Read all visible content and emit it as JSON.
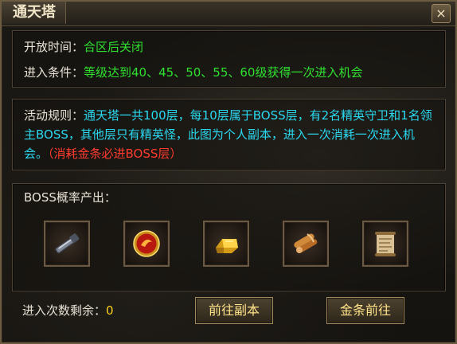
{
  "window": {
    "title": "通天塔",
    "close_icon": "close-icon"
  },
  "info": {
    "open_time_label": "开放时间：",
    "open_time_value": "合区后关闭",
    "entry_label": "进入条件：",
    "entry_value": "等级达到40、45、50、55、60级获得一次进入机会"
  },
  "rules": {
    "label": "活动规则：",
    "text": "通天塔一共100层，每10层属于BOSS层，有2名精英守卫和1名领主BOSS，其他层只有精英怪，此图为个人副本，进入一次消耗一次进入机会。",
    "note": "（消耗金条必进BOSS层）"
  },
  "drops": {
    "label": "BOSS概率产出：",
    "items": [
      {
        "icon": "scroll-blade-icon"
      },
      {
        "icon": "red-orb-icon"
      },
      {
        "icon": "gold-bar-icon"
      },
      {
        "icon": "rolled-scroll-icon"
      },
      {
        "icon": "map-scroll-icon"
      }
    ]
  },
  "footer": {
    "remaining_label": "进入次数剩余：",
    "remaining_value": "0",
    "goto_dungeon_label": "前往副本",
    "gold_goto_label": "金条前往"
  },
  "colors": {
    "green": "#2fe02f",
    "cyan": "#2ad9f0",
    "red": "#ff3b2e",
    "yellow": "#ffd21f",
    "border": "#6b5c42"
  }
}
